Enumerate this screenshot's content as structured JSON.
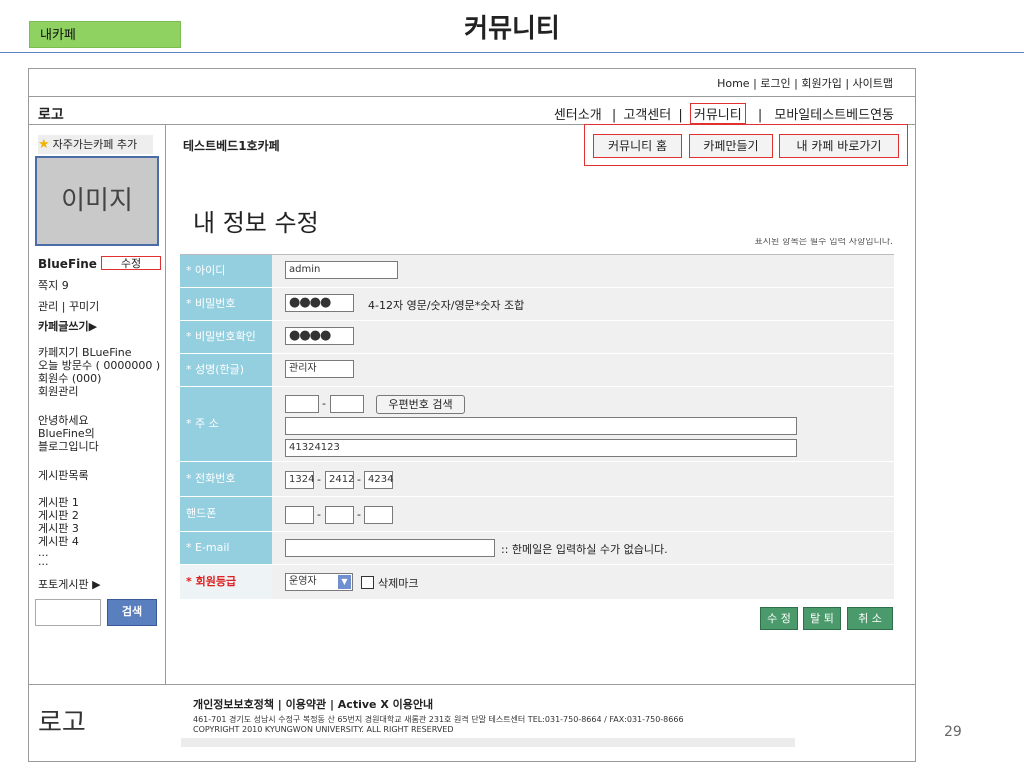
{
  "slide": {
    "tag": "내카페",
    "title": "커뮤니티",
    "page_number": "29"
  },
  "header": {
    "util_links": "Home | 로그인 | 회원가입 | 사이트맵",
    "logo": "로고",
    "nav": {
      "item1": "센터소개",
      "sep1": "|",
      "item2": "고객센터",
      "sep2": "|",
      "item3": "커뮤니티",
      "sep3": "|",
      "item4": "모바일테스트베드연동"
    }
  },
  "sidebar": {
    "favorite": "자주가는카페 추가",
    "image_placeholder": "이미지",
    "username": "BlueFine",
    "edit_label": "수정",
    "messages": "쪽지 9",
    "manage": "관리 | 꾸미기",
    "write": "카페글쓰기▶",
    "info": [
      "카페지기 BLueFine",
      "오늘 방문수 ( 0000000 )",
      "회원수 (000)",
      "회원관리"
    ],
    "greeting": [
      "안녕하세요",
      "BlueFine의",
      "블로그입니다"
    ],
    "board_title": "게시판목록",
    "boards": [
      "게시판 1",
      "게시판 2",
      "게시판 3",
      "게시판 4",
      "...",
      "..."
    ],
    "photo_board": "포토게시판 ▶",
    "search_label": "검색"
  },
  "main": {
    "cafe_name": "테스트베드1호카페",
    "buttons": {
      "home": "커뮤니티 홈",
      "create": "카페만들기",
      "goto": "내 카페 바로가기"
    },
    "page_title": "내 정보 수정",
    "notice": "표시된 항목은 필수 입력 사항입니다.",
    "form": {
      "id_label": "* 아이디",
      "id_value": "admin",
      "pw_label": "* 비밀번호",
      "pw_value": "●●●●",
      "pw_hint": "4-12자 영문/숫자/영문*숫자 조합",
      "pw2_label": "* 비밀번호확인",
      "pw2_value": "●●●●",
      "name_label": "* 성명(한글)",
      "name_value": "관리자",
      "addr_label": "* 주 소",
      "zip_dash": "-",
      "zip_button": "우편번호 검색",
      "addr_detail": "41324123",
      "tel_label": "* 전화번호",
      "tel1": "1324",
      "tel2": "2412",
      "tel3": "4234",
      "tel_dash": "-",
      "mobile_label": "핸드폰",
      "email_label": "* E-mail",
      "email_hint": ":: 한메일은 입력하실 수가 없습니다.",
      "grade_label": "* 회원등급",
      "grade_value": "운영자",
      "delete_mark": "삭제마크"
    },
    "actions": {
      "edit": "수 정",
      "withdraw": "탈 퇴",
      "cancel": "취 소"
    }
  },
  "footer": {
    "logo": "로고",
    "links": "개인정보보호정책 | 이용약관 | Active X 이용안내",
    "address": "461-701 경기도 성남시 수정구 복정동 산 65번지 경원대학교 새롬관 231호 원격 단말 테스트센터 TEL:031-750-8664 / FAX:031-750-8666",
    "copyright": "COPYRIGHT 2010 KYUNGWON UNIVERSITY. ALL RIGHT RESERVED"
  }
}
